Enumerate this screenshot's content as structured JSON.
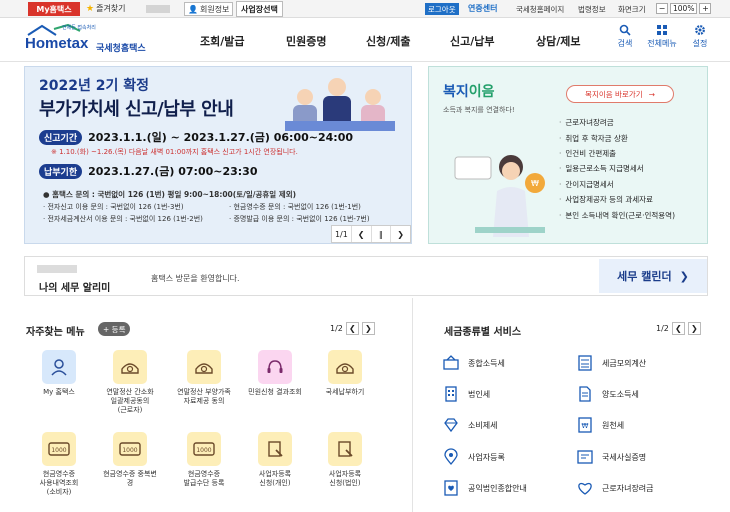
{
  "topbar": {
    "my_hometax": "My홈택스",
    "favorites": "즐겨찾기",
    "member_info": "회원정보",
    "business_select": "사업장선택",
    "logout": "로그아웃",
    "contact": "연중센터",
    "links": [
      "국세청홈페이지",
      "법령정보",
      "화면크기"
    ],
    "zoom": "100%"
  },
  "header": {
    "logo_small": "언제든 접속처리",
    "logo_brand": "Hometax",
    "logo_org": "국세청홈택스",
    "nav": [
      "조회/발급",
      "민원증명",
      "신청/제출",
      "신고/납부",
      "상담/제보"
    ],
    "icons": [
      {
        "label": "검색",
        "icon": "search-icon"
      },
      {
        "label": "전체메뉴",
        "icon": "grid-menu-icon"
      },
      {
        "label": "설정",
        "icon": "gear-icon"
      }
    ]
  },
  "banner": {
    "title_line1": "2022년 2기 확정",
    "title_line2": "부가가치세 신고/납부 안내",
    "filing_label": "신고기간",
    "filing_value": "2023.1.1.(일) ~ 2023.1.27.(금) 06:00~24:00",
    "filing_note": "※ 1.10.(화) ~1.26.(목) 다음날 새벽 01:00까지 홈택스 신고가 1시간 연장됩니다.",
    "payment_label": "납부기한",
    "payment_value": "2023.1.27.(금) 07:00~23:30",
    "inquiry_main": "● 홈택스 문의 : 국번없이 126 (1번) 평일 9:00~18:00(토/일/공휴일 제외)",
    "inquiries": [
      "· 전자신고 이용 문의 : 국번없이 126 (1번-3번)",
      "· 현금영수증 문의 : 국번없이 126 (1번-1번)",
      "· 전자세금계산서 이용 문의 : 국번없이 126 (1번-2번)",
      "· 증명발급 이용 문의 : 국번없이 126 (1번-7번)"
    ],
    "page_indicator": "1/1"
  },
  "welfare": {
    "title_a": "복지",
    "title_b": "이음",
    "subtitle": "소득과 복지를 연결하다!",
    "button": "복지이음 바로가기",
    "items": [
      "근로자녀장려금",
      "취업 후 학자금 상환",
      "인건비 간편제출",
      "일용근로소득 지급명세서",
      "간이지급명세서",
      "사업장제공자 등의 과세자료",
      "본인 소득내역 확인(근로·인적용역)"
    ]
  },
  "notice": {
    "title": "나의 세무 알리미",
    "text": "홈택스 방문을 환영합니다.",
    "calendar": "세무 캘린더"
  },
  "faq": {
    "title": "자주찾는 메뉴",
    "add": "+ 등록",
    "page": "1/2",
    "items": [
      {
        "label": "My 홈택스",
        "icon": "user-icon"
      },
      {
        "label": "연말정산 간소화\n일괄제공동의\n(근로자)",
        "icon": "tax-doc-icon"
      },
      {
        "label": "연말정산 부양가족\n자료제공 동의",
        "icon": "tax-doc-icon"
      },
      {
        "label": "민원신청 결과조회",
        "icon": "headset-icon"
      },
      {
        "label": "국세납부하기",
        "icon": "tax-doc-icon"
      },
      {
        "label": "현금영수증\n사용내역조회\n(소비자)",
        "icon": "receipt-icon"
      },
      {
        "label": "현금영수증 중복변\n경",
        "icon": "receipt-icon"
      },
      {
        "label": "현금영수증\n발급수단 등록",
        "icon": "receipt-icon"
      },
      {
        "label": "사업자등록\n신청(개인)",
        "icon": "stamp-icon"
      },
      {
        "label": "사업자등록\n신청(법인)",
        "icon": "stamp-icon"
      }
    ]
  },
  "services": {
    "title": "세금종류별 서비스",
    "page": "1/2",
    "items": [
      {
        "label": "종합소득세",
        "icon": "income-tax-icon"
      },
      {
        "label": "세금모의계산",
        "icon": "calculator-icon"
      },
      {
        "label": "법인세",
        "icon": "building-icon"
      },
      {
        "label": "양도소득세",
        "icon": "document-icon"
      },
      {
        "label": "소비제세",
        "icon": "gem-icon"
      },
      {
        "label": "원천세",
        "icon": "withholding-icon"
      },
      {
        "label": "사업자등록",
        "icon": "pin-icon"
      },
      {
        "label": "국세사실증명",
        "icon": "certificate-icon"
      },
      {
        "label": "공익법인종합안내",
        "icon": "charity-icon"
      },
      {
        "label": "근로자녀장려금",
        "icon": "heart-icon"
      }
    ]
  }
}
